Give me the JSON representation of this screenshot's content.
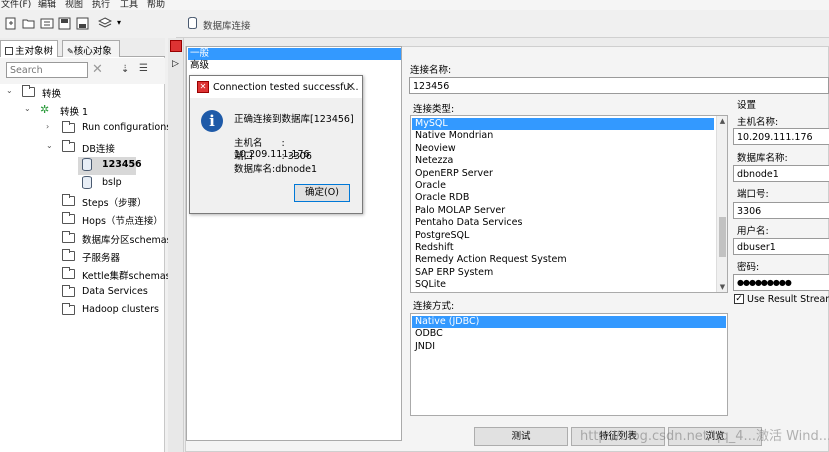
{
  "menu": [
    "文件(F)",
    "编辑",
    "视图",
    "执行",
    "工具",
    "帮助"
  ],
  "main_tab_title": "数据库连接",
  "left_tabs": [
    "主对象树",
    "核心对象"
  ],
  "search": {
    "placeholder": "Search"
  },
  "tree": [
    {
      "label": "转换",
      "level": 0,
      "arrow": "⌄",
      "icon": "folder-icon"
    },
    {
      "label": "转换 1",
      "level": 1,
      "arrow": "⌄",
      "icon": "transformation-icon"
    },
    {
      "label": "Run configurations",
      "level": 2,
      "arrow": "›",
      "icon": "folder-icon"
    },
    {
      "label": "DB连接",
      "level": 2,
      "arrow": "⌄",
      "icon": "folder-icon"
    },
    {
      "label": "123456",
      "level": 3,
      "arrow": "",
      "icon": "database-icon",
      "selected": true
    },
    {
      "label": "bslp",
      "level": 3,
      "arrow": "",
      "icon": "database-icon"
    },
    {
      "label": "Steps（步骤）",
      "level": 2,
      "arrow": "",
      "icon": "folder-icon"
    },
    {
      "label": "Hops（节点连接）",
      "level": 2,
      "arrow": "",
      "icon": "folder-icon"
    },
    {
      "label": "数据库分区schemas",
      "level": 2,
      "arrow": "",
      "icon": "folder-icon"
    },
    {
      "label": "子服务器",
      "level": 2,
      "arrow": "",
      "icon": "folder-icon"
    },
    {
      "label": "Kettle集群schemas",
      "level": 2,
      "arrow": "",
      "icon": "folder-icon"
    },
    {
      "label": "Data Services",
      "level": 2,
      "arrow": "",
      "icon": "folder-icon"
    },
    {
      "label": "Hadoop clusters",
      "level": 2,
      "arrow": "",
      "icon": "folder-icon"
    }
  ],
  "categories": [
    "一般",
    "高级"
  ],
  "connection_name": {
    "label": "连接名称:",
    "value": "123456"
  },
  "connection_type": {
    "label": "连接类型:",
    "items": [
      "MySQL",
      "Native Mondrian",
      "Neoview",
      "Netezza",
      "OpenERP Server",
      "Oracle",
      "Oracle RDB",
      "Palo MOLAP Server",
      "Pentaho Data Services",
      "PostgreSQL",
      "Redshift",
      "Remedy Action Request System",
      "SAP ERP System",
      "SQLite"
    ],
    "selected": "MySQL"
  },
  "access_method": {
    "label": "连接方式:",
    "items": [
      "Native (JDBC)",
      "ODBC",
      "JNDI"
    ],
    "selected": "Native (JDBC)"
  },
  "settings": {
    "title": "设置",
    "host_label": "主机名称:",
    "host_value": "10.209.111.176",
    "db_label": "数据库名称:",
    "db_value": "dbnode1",
    "port_label": "端口号:",
    "port_value": "3306",
    "user_label": "用户名:",
    "user_value": "dbuser1",
    "password_label": "密码:",
    "password_value": "●●●●●●●●●",
    "streaming_label": "Use Result Streaming"
  },
  "buttons": {
    "test": "测试",
    "feature_list": "特征列表",
    "explore": "浏览"
  },
  "popup": {
    "title": "Connection tested successfu...",
    "message": "正确连接到数据库[123456]",
    "host_line": "主机名　　: 10.209.111.176",
    "port_line": "端口　　　: 3306",
    "db_line": "数据库名:dbnode1",
    "ok": "确定(O)"
  },
  "watermark": "http://blog.csdn.net/qq_4...激活 Wind..."
}
